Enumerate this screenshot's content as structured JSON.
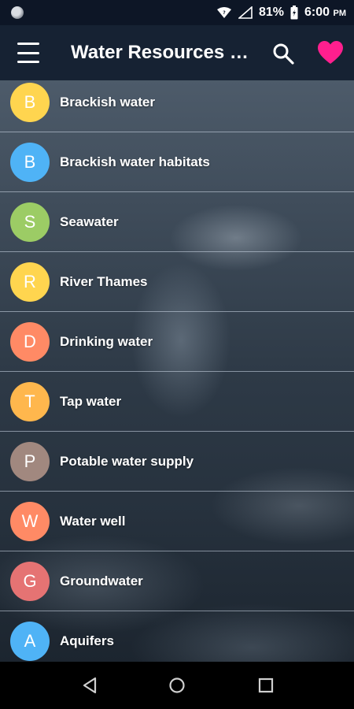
{
  "status_bar": {
    "battery": "81%",
    "time": "6:00",
    "ampm": "PM"
  },
  "app_bar": {
    "title": "Water Resources E...",
    "icons": [
      "menu-icon",
      "search-icon",
      "heart-icon"
    ],
    "accent_color": "#ff1f8e",
    "background_color": "#162233"
  },
  "list": {
    "items": [
      {
        "letter": "B",
        "label": "Brackish water",
        "color": "#ffd54f"
      },
      {
        "letter": "B",
        "label": "Brackish water habitats",
        "color": "#4fb3f6"
      },
      {
        "letter": "S",
        "label": "Seawater",
        "color": "#9ccc65"
      },
      {
        "letter": "R",
        "label": "River Thames",
        "color": "#ffd54f"
      },
      {
        "letter": "D",
        "label": "Drinking water",
        "color": "#ff8a65"
      },
      {
        "letter": "T",
        "label": "Tap water",
        "color": "#ffb74d"
      },
      {
        "letter": "P",
        "label": "Potable water supply",
        "color": "#a1887f"
      },
      {
        "letter": "W",
        "label": "Water well",
        "color": "#ff8a65"
      },
      {
        "letter": "G",
        "label": "Groundwater",
        "color": "#e57373"
      },
      {
        "letter": "A",
        "label": "Aquifers",
        "color": "#4fb3f6"
      }
    ]
  },
  "nav_bar": {
    "icons": [
      "back-icon",
      "home-icon",
      "recents-icon"
    ]
  }
}
